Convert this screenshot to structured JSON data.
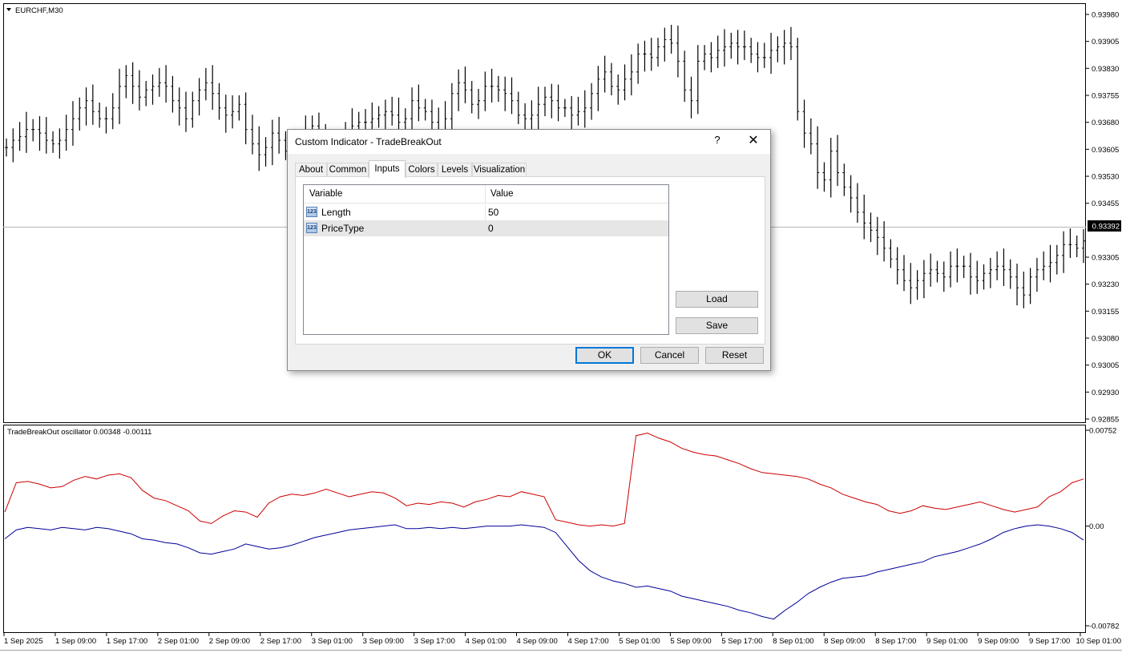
{
  "window": {
    "symbol_label": "EURCHF,M30"
  },
  "price_axis": {
    "labels": [
      "0.93980",
      "0.93905",
      "0.93830",
      "0.93755",
      "0.93680",
      "0.93605",
      "0.93530",
      "0.93455",
      "0.93305",
      "0.93230",
      "0.93155",
      "0.93080",
      "0.93005",
      "0.92930",
      "0.92855"
    ],
    "current_price": "0.93392"
  },
  "time_axis": {
    "labels": [
      "1 Sep 2025",
      "1 Sep 09:00",
      "1 Sep 17:00",
      "2 Sep 01:00",
      "2 Sep 09:00",
      "2 Sep 17:00",
      "3 Sep 01:00",
      "3 Sep 09:00",
      "3 Sep 17:00",
      "4 Sep 01:00",
      "4 Sep 09:00",
      "4 Sep 17:00",
      "5 Sep 01:00",
      "5 Sep 09:00",
      "5 Sep 17:00",
      "8 Sep 01:00",
      "8 Sep 09:00",
      "8 Sep 17:00",
      "9 Sep 01:00",
      "9 Sep 09:00",
      "9 Sep 17:00",
      "10 Sep 01:00"
    ]
  },
  "oscillator": {
    "label": "TradeBreakOut oscillator 0.00348 -0.00111",
    "axis_labels": [
      "0.00752",
      "0.00",
      "-0.00782"
    ]
  },
  "colors": {
    "red_line": "#cc0000",
    "blue_line": "#000099",
    "accent": "#0078d7"
  },
  "chart_data": [
    {
      "type": "bar",
      "subtype": "ohlc",
      "title": "EURCHF,M30",
      "ylim": [
        0.92855,
        0.9398
      ],
      "current_price": 0.93392,
      "series": [
        {
          "values": [
            0.9361,
            0.9363,
            0.9364,
            0.9366,
            0.9366,
            0.9365,
            0.9363,
            0.9362,
            0.9363,
            0.9366,
            0.9369,
            0.9372,
            0.9374,
            0.9371,
            0.9369,
            0.9369,
            0.9372,
            0.9378,
            0.9381,
            0.9378,
            0.9375,
            0.9377,
            0.9378,
            0.9379,
            0.9378,
            0.9374,
            0.9372,
            0.9369,
            0.9374,
            0.9377,
            0.9379,
            0.9376,
            0.9372,
            0.937,
            0.9371,
            0.9373,
            0.9366,
            0.9362,
            0.9359,
            0.9361,
            0.9365,
            0.9363,
            0.936,
            0.9358,
            0.936,
            0.9365,
            0.9367,
            0.9363,
            0.936,
            0.9361,
            0.936,
            0.9364,
            0.9367,
            0.9368,
            0.9368,
            0.9369,
            0.937,
            0.9371,
            0.937,
            0.9368,
            0.9369,
            0.9374,
            0.9372,
            0.9371,
            0.9368,
            0.9366,
            0.9369,
            0.9376,
            0.9379,
            0.9377,
            0.9373,
            0.9374,
            0.9378,
            0.9378,
            0.9377,
            0.9376,
            0.9374,
            0.937,
            0.9369,
            0.937,
            0.9373,
            0.9375,
            0.9374,
            0.9372,
            0.9372,
            0.937,
            0.9371,
            0.9372,
            0.9376,
            0.938,
            0.9382,
            0.9378,
            0.9377,
            0.938,
            0.9382,
            0.9387,
            0.9387,
            0.9386,
            0.9389,
            0.9391,
            0.939,
            0.9385,
            0.9377,
            0.9374,
            0.9385,
            0.9387,
            0.9386,
            0.9388,
            0.9389,
            0.939,
            0.9389,
            0.9389,
            0.9387,
            0.9386,
            0.9386,
            0.9388,
            0.9389,
            0.939,
            0.9389,
            0.9371,
            0.9365,
            0.9362,
            0.9354,
            0.9352,
            0.936,
            0.9354,
            0.935,
            0.9347,
            0.9343,
            0.934,
            0.9338,
            0.9336,
            0.9333,
            0.933,
            0.9327,
            0.9324,
            0.9322,
            0.9324,
            0.9326,
            0.9327,
            0.9326,
            0.9325,
            0.9328,
            0.9328,
            0.9328,
            0.9325,
            0.9324,
            0.9326,
            0.9327,
            0.9328,
            0.9327,
            0.9325,
            0.9322,
            0.932,
            0.9325,
            0.9327,
            0.9328,
            0.9329,
            0.9331,
            0.9334,
            0.9334,
            0.9333,
            0.9335
          ]
        }
      ]
    },
    {
      "type": "line",
      "title": "TradeBreakOut oscillator 0.00348 -0.00111",
      "ylim": [
        -0.00782,
        0.00752
      ],
      "series": [
        {
          "color": "#cc0000",
          "values": [
            0.0011,
            0.0034,
            0.0035,
            0.0033,
            0.003,
            0.0031,
            0.0036,
            0.0039,
            0.0037,
            0.004,
            0.0041,
            0.0038,
            0.0028,
            0.0022,
            0.002,
            0.0016,
            0.0012,
            0.0004,
            0.0002,
            0.0008,
            0.0012,
            0.0011,
            0.0007,
            0.0018,
            0.0023,
            0.0025,
            0.0024,
            0.0026,
            0.0029,
            0.0026,
            0.0023,
            0.0025,
            0.0027,
            0.0026,
            0.0022,
            0.0016,
            0.0018,
            0.0017,
            0.0019,
            0.0018,
            0.0015,
            0.0019,
            0.0021,
            0.0024,
            0.0023,
            0.0027,
            0.0025,
            0.0023,
            0.0005,
            0.0003,
            0.0001,
            0.0,
            0.0001,
            0.0,
            0.0002,
            0.0071,
            0.0073,
            0.0069,
            0.0066,
            0.0061,
            0.0058,
            0.0056,
            0.0055,
            0.0052,
            0.0049,
            0.0045,
            0.0042,
            0.0041,
            0.004,
            0.0039,
            0.0037,
            0.0033,
            0.003,
            0.0025,
            0.0022,
            0.0019,
            0.0017,
            0.0012,
            0.001,
            0.0012,
            0.0016,
            0.0014,
            0.0013,
            0.0015,
            0.0017,
            0.0019,
            0.0016,
            0.0013,
            0.0011,
            0.0013,
            0.0015,
            0.0023,
            0.0027,
            0.0034,
            0.0037
          ]
        },
        {
          "color": "#000099",
          "values": [
            -0.001,
            -0.0003,
            -0.0001,
            -0.0002,
            -0.0003,
            -0.0001,
            -0.0002,
            -0.0003,
            -0.0001,
            -0.0002,
            -0.0004,
            -0.0006,
            -0.001,
            -0.0011,
            -0.0013,
            -0.0014,
            -0.0017,
            -0.0021,
            -0.0022,
            -0.002,
            -0.0018,
            -0.0014,
            -0.0016,
            -0.0018,
            -0.0017,
            -0.0015,
            -0.0012,
            -0.0009,
            -0.0007,
            -0.0005,
            -0.0003,
            -0.0002,
            -0.0001,
            0.0,
            0.0001,
            -0.0002,
            -0.0002,
            -0.0001,
            -0.0002,
            -0.0001,
            -0.0002,
            -0.0001,
            0.0,
            0.0,
            0.0,
            0.0001,
            0.0,
            -0.0001,
            -0.0005,
            -0.0016,
            -0.0027,
            -0.0035,
            -0.004,
            -0.0043,
            -0.0045,
            -0.0048,
            -0.0047,
            -0.0049,
            -0.0051,
            -0.0055,
            -0.0057,
            -0.0059,
            -0.0061,
            -0.0063,
            -0.0066,
            -0.0068,
            -0.0071,
            -0.0073,
            -0.0066,
            -0.006,
            -0.0053,
            -0.0048,
            -0.0044,
            -0.0041,
            -0.004,
            -0.0039,
            -0.0036,
            -0.0034,
            -0.0032,
            -0.003,
            -0.0028,
            -0.0024,
            -0.0022,
            -0.002,
            -0.0017,
            -0.0014,
            -0.001,
            -0.0005,
            -0.0002,
            0.0,
            0.0001,
            0.0,
            -0.0002,
            -0.0005,
            -0.0011
          ]
        }
      ]
    }
  ],
  "dialog": {
    "title": "Custom Indicator - TradeBreakOut",
    "help_glyph": "?",
    "close_glyph": "✕",
    "tabs": [
      "About",
      "Common",
      "Inputs",
      "Colors",
      "Levels",
      "Visualization"
    ],
    "active_tab": "Inputs",
    "grid": {
      "headers": [
        "Variable",
        "Value"
      ],
      "rows": [
        {
          "variable": "Length",
          "value": "50"
        },
        {
          "variable": "PriceType",
          "value": "0"
        }
      ],
      "icon_text": "123"
    },
    "buttons": {
      "load": "Load",
      "save": "Save",
      "ok": "OK",
      "cancel": "Cancel",
      "reset": "Reset"
    }
  }
}
